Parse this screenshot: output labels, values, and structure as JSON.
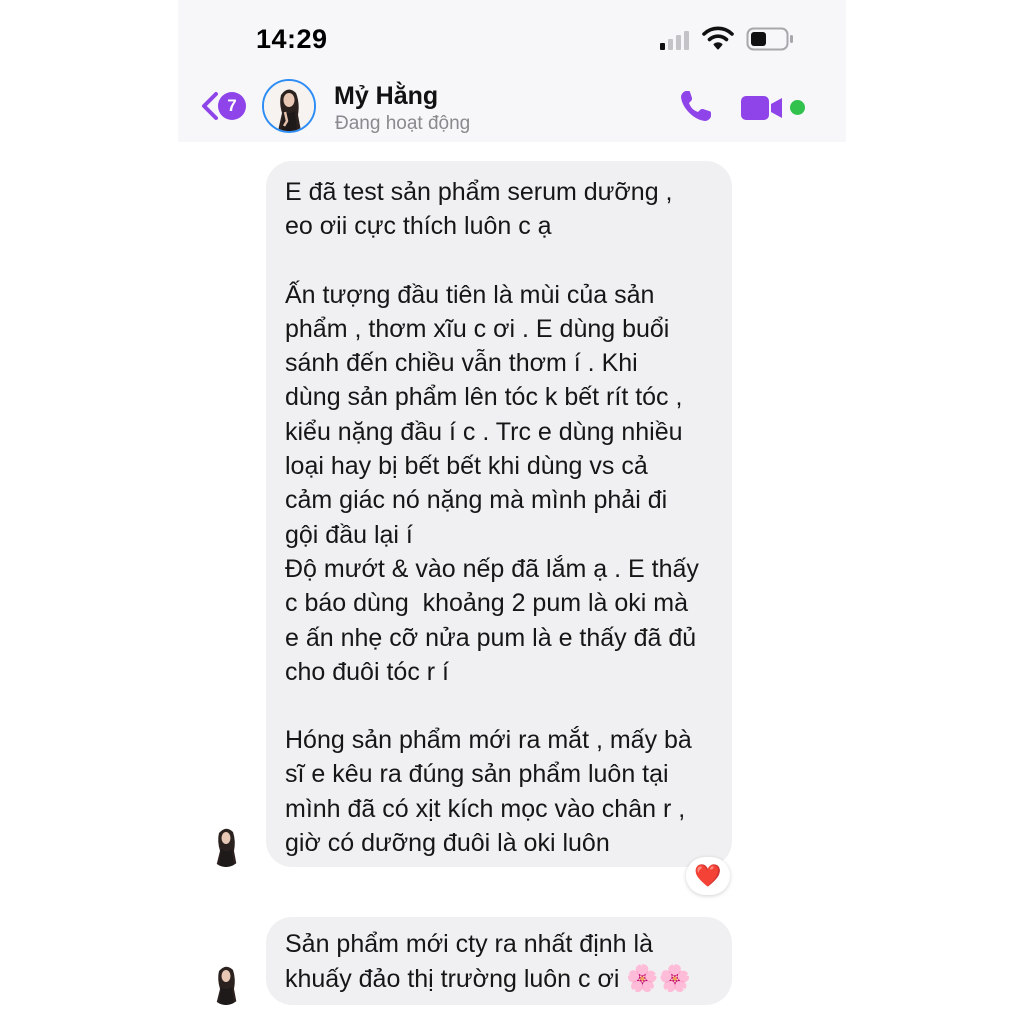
{
  "status_bar": {
    "time": "14:29"
  },
  "header": {
    "unread_count": "7",
    "contact_name": "Mỷ Hằng",
    "contact_status": "Đang hoạt động"
  },
  "messages": [
    {
      "paragraphs": [
        [
          "E đã test sản phẩm serum dưỡng ,",
          "eo ơii cực thích luôn c ạ"
        ],
        [
          "Ấn tượng đầu tiên là mùi của sản",
          "phẩm , thơm xĩu c ơi . E dùng buổi",
          "sánh đến chiều vẫn thơm í . Khi",
          "dùng sản phẩm lên tóc k bết rít tóc ,",
          "kiểu nặng đầu í c . Trc e dùng nhiều",
          "loại hay bị bết bết khi dùng vs cả",
          "cảm giác nó nặng mà mình phải đi",
          "gội đầu lại í",
          "Độ mướt & vào nếp đã lắm ạ . E thấy",
          "c báo dùng  khoảng 2 pum là oki mà",
          "e ấn nhẹ cỡ nửa pum là e thấy đã đủ",
          "cho đuôi tóc r í"
        ],
        [
          "Hóng sản phẩm mới ra mắt , mấy bà",
          "sĩ e kêu ra đúng sản phẩm luôn tại",
          "mình đã có xịt kích mọc vào chân r ,",
          "giờ có dưỡng đuôi là oki luôn"
        ]
      ],
      "reaction": "❤️"
    },
    {
      "lines": [
        "Sản phẩm mới cty ra nhất định là",
        "khuấy đảo thị trường luôn c ơi "
      ],
      "emoji": "🌸🌸"
    }
  ],
  "colors": {
    "accent": "#8e44e8",
    "bubble": "#f0f0f2",
    "online": "#31c24d",
    "avatar_ring": "#2e8df5"
  },
  "icons": [
    "back-chevron-icon",
    "phone-icon",
    "video-camera-icon",
    "signal-icon",
    "wifi-icon",
    "battery-icon"
  ]
}
